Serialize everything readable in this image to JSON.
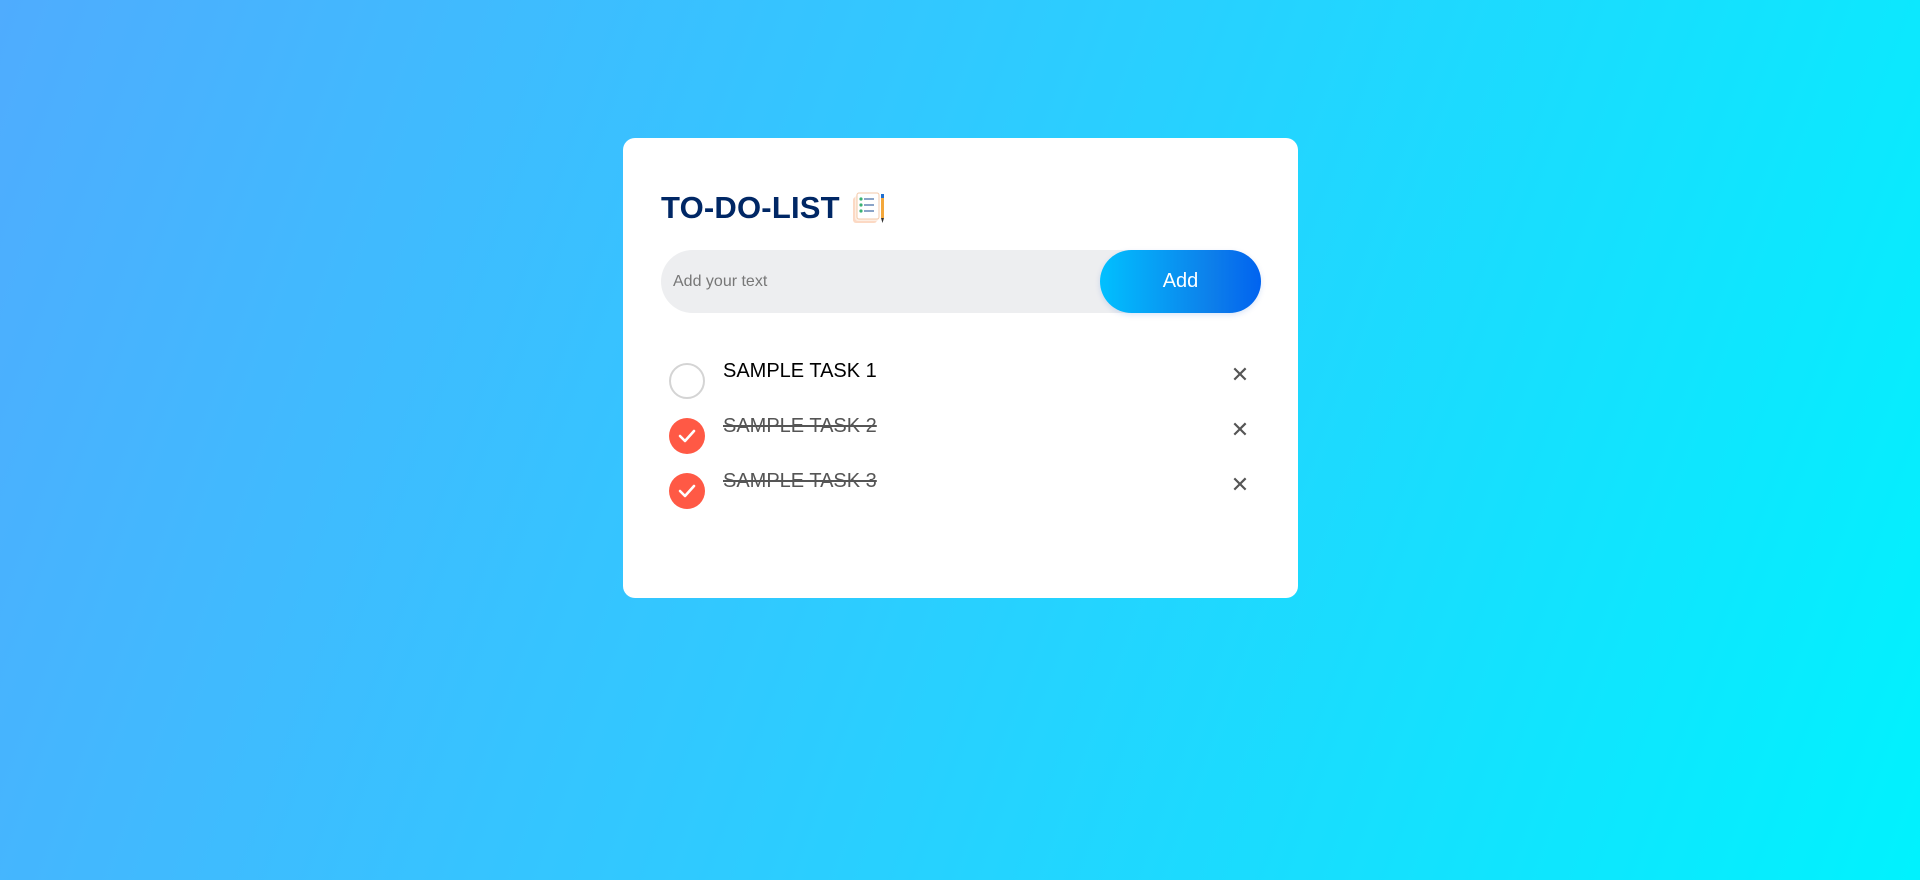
{
  "app": {
    "title": "TO-DO-LIST",
    "title_icon": "notepad-icon"
  },
  "input": {
    "placeholder": "Add your text",
    "value": ""
  },
  "add_button": {
    "label": "Add"
  },
  "tasks": [
    {
      "text": "SAMPLE TASK 1",
      "checked": false,
      "delete_icon": "close-icon",
      "delete_glyph": "✕"
    },
    {
      "text": "SAMPLE TASK 2",
      "checked": true,
      "delete_icon": "close-icon",
      "delete_glyph": "✕"
    },
    {
      "text": "SAMPLE TASK 3",
      "checked": true,
      "delete_icon": "close-icon",
      "delete_glyph": "✕"
    }
  ],
  "colors": {
    "background_start": "#4facfe",
    "background_end": "#00f2fe",
    "title": "#002765",
    "checked": "#ff5945",
    "add_button_start": "#01c0ff",
    "add_button_end": "#0063f0"
  }
}
